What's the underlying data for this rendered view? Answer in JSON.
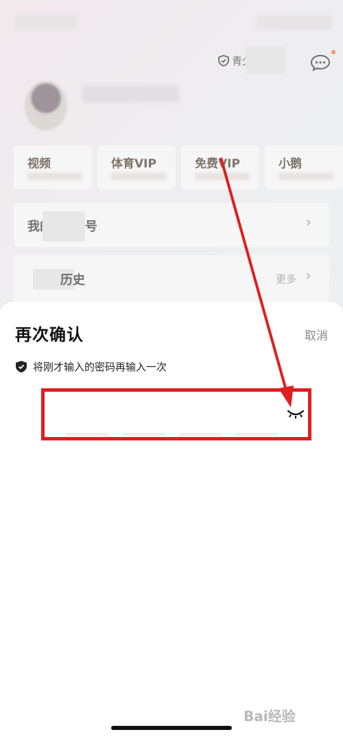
{
  "background": {
    "teen_mode_label": "青少",
    "vip_cards": [
      "视频",
      "体育VIP",
      "免费VIP",
      "小鹅"
    ],
    "list_rows": [
      {
        "title": "我的",
        "suffix": "号"
      },
      {
        "title": "历史",
        "more": "更多"
      }
    ]
  },
  "sheet": {
    "title": "再次确认",
    "cancel_label": "取消",
    "hint": "将刚才输入的密码再输入一次",
    "password_value": ""
  },
  "colors": {
    "annotation_red": "#e01e1e",
    "sheet_bg": "#ffffff",
    "muted_text": "#888888"
  },
  "icons": {
    "shield": "shield-icon",
    "eye_closed": "eye-closed-icon",
    "message": "message-icon",
    "chevron": "chevron-right-icon"
  },
  "watermark": "Bai经验"
}
